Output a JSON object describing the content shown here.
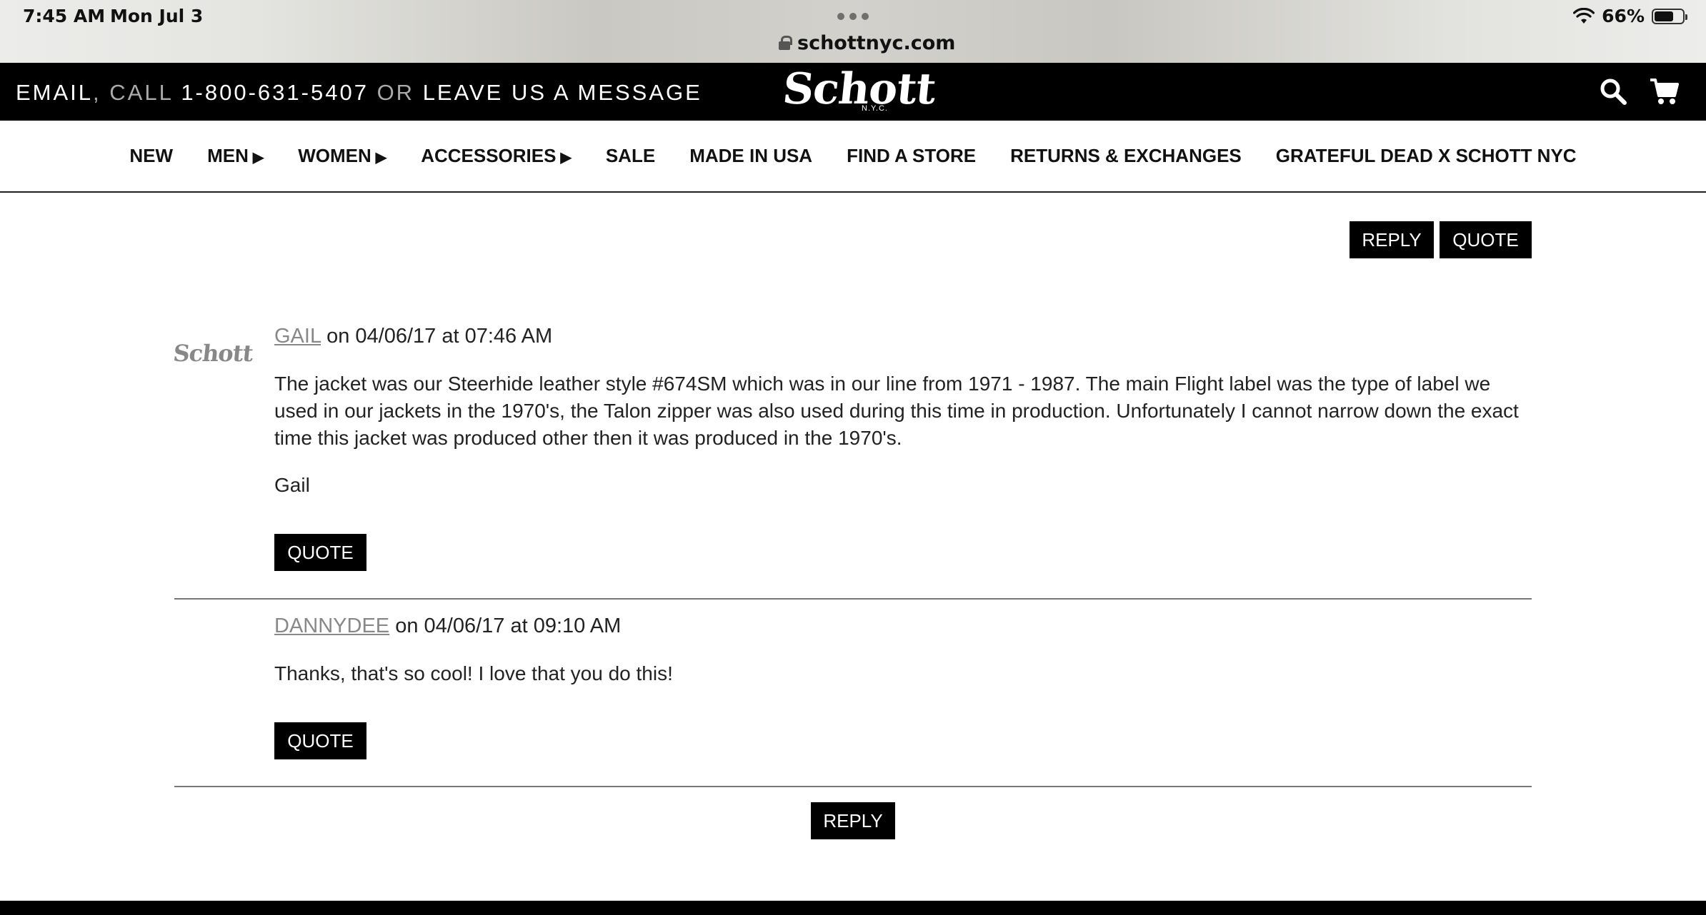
{
  "status_bar": {
    "time": "7:45 AM",
    "date": "Mon Jul 3",
    "url": "schottnyc.com",
    "battery": "66%"
  },
  "header": {
    "contact_email": "EMAIL",
    "contact_comma": ",",
    "contact_call": "CALL",
    "contact_phone": "1-800-631-5407",
    "contact_or": "OR",
    "contact_message": "LEAVE US A MESSAGE",
    "logo_text": "Schott",
    "logo_sub": "N.Y.C."
  },
  "nav": {
    "items": [
      {
        "label": "NEW",
        "arrow": ""
      },
      {
        "label": "MEN",
        "arrow": "▶"
      },
      {
        "label": "WOMEN",
        "arrow": "▶"
      },
      {
        "label": "ACCESSORIES",
        "arrow": "▶"
      },
      {
        "label": "SALE",
        "arrow": ""
      },
      {
        "label": "MADE IN USA",
        "arrow": ""
      },
      {
        "label": "FIND A STORE",
        "arrow": ""
      },
      {
        "label": "RETURNS & EXCHANGES",
        "arrow": ""
      },
      {
        "label": "GRATEFUL DEAD X SCHOTT NYC",
        "arrow": ""
      }
    ]
  },
  "top_actions": {
    "reply_label": "REPLY",
    "quote_label": "QUOTE"
  },
  "comments": [
    {
      "avatar_text": "Schott",
      "author": "GAIL",
      "meta": " on 04/06/17 at 07:46 AM",
      "body": "The jacket was our Steerhide leather style #674SM which was in our line from 1971 - 1987. The main Flight label was the type of label we used in our jackets in the 1970's, the Talon zipper was also used during this time in production. Unfortunately I cannot narrow down the exact time this jacket was produced other then it was produced in the 1970's.",
      "signature": "Gail",
      "quote_label": "QUOTE"
    },
    {
      "author": "DANNYDEE",
      "meta": " on 04/06/17 at 09:10 AM",
      "body": "Thanks, that's so cool! I love that you do this!",
      "quote_label": "QUOTE"
    }
  ],
  "bottom_reply_label": "REPLY",
  "colors": {
    "brand_black": "#000000",
    "author_link": "#888888",
    "divider": "#777777"
  }
}
